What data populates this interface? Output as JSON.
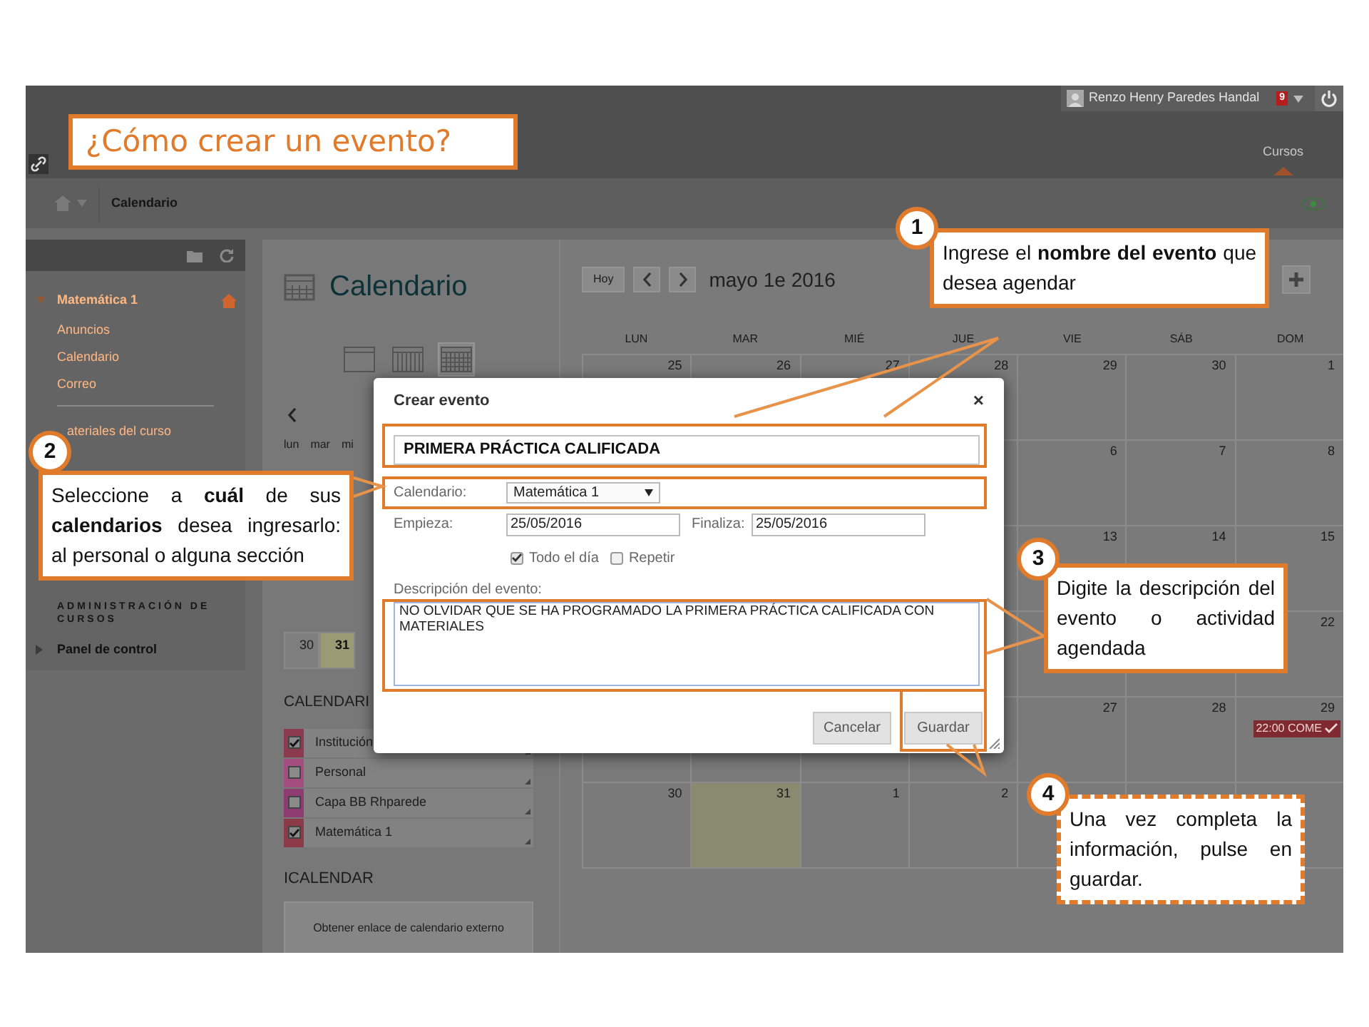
{
  "slide_title": "¿Cómo crear un evento?",
  "top_bar": {
    "user": "Renzo Henry Paredes Handal",
    "notification_count": "9"
  },
  "header": {
    "tab": "Cursos"
  },
  "breadcrumb": "Calendario",
  "sidebar": {
    "course": "Matemática 1",
    "items": [
      "Anuncios",
      "Calendario",
      "Correo"
    ],
    "materials": "ateriales del curso",
    "admin_heading": "ADMINISTRACIÓN DE CURSOS",
    "control_panel": "Panel de control"
  },
  "page_title": "Calendario",
  "views": [
    {
      "kind": "day",
      "selected": false
    },
    {
      "kind": "week",
      "selected": false
    },
    {
      "kind": "month",
      "selected": true
    }
  ],
  "mini_calendar": {
    "weekdays": [
      "lun",
      "mar",
      "mi"
    ],
    "days": [
      {
        "label": "30",
        "selected": false
      },
      {
        "label": "31",
        "selected": true
      }
    ]
  },
  "calendars_heading": "CALENDARI",
  "calendars": [
    {
      "name": "Institución",
      "checked": true,
      "color": "#8c3b4e"
    },
    {
      "name": "Personal",
      "checked": false,
      "color": "#a34d80"
    },
    {
      "name": "Capa BB Rhparede",
      "checked": false,
      "color": "#8d3b70"
    },
    {
      "name": "Matemática 1",
      "checked": true,
      "color": "#8c3a48"
    }
  ],
  "icalendar": {
    "heading": "ICALENDAR",
    "button": "Obtener enlace de calendario externo"
  },
  "calendar": {
    "today_button": "Hoy",
    "month": "mayo 1e 2016",
    "weekdays": [
      "LUN",
      "MAR",
      "MIÉ",
      "JUE",
      "VIE",
      "SÁB",
      "DOM"
    ],
    "weeks": [
      {
        "days": [
          {
            "label": "25",
            "today": false
          },
          {
            "label": "26",
            "today": false
          },
          {
            "label": "27",
            "today": false
          },
          {
            "label": "28",
            "today": false
          },
          {
            "label": "29",
            "today": false
          },
          {
            "label": "30",
            "today": false
          },
          {
            "label": "1",
            "today": false
          }
        ]
      },
      {
        "days": [
          {
            "label": "6",
            "today": false
          },
          {
            "label": "7",
            "today": false
          },
          {
            "label": "8",
            "today": false
          }
        ]
      },
      {
        "days": [
          {
            "label": "13",
            "today": false
          },
          {
            "label": "14",
            "today": false
          },
          {
            "label": "15",
            "today": false
          }
        ]
      },
      {
        "days": [
          {
            "label": "22",
            "today": false
          }
        ]
      },
      {
        "days": [
          {
            "label": "27",
            "today": false
          },
          {
            "label": "28",
            "today": false
          },
          {
            "label": "29",
            "today": false,
            "event": "22:00 COME"
          }
        ]
      },
      {
        "days": [
          {
            "label": "30",
            "today": false
          },
          {
            "label": "31",
            "today": true
          },
          {
            "label": "1",
            "today": false
          },
          {
            "label": "2",
            "today": false
          }
        ]
      }
    ]
  },
  "modal": {
    "title": "Crear evento",
    "close": "×",
    "name": "PRIMERA PRÁCTICA CALIFICADA",
    "calendar_label": "Calendario:",
    "calendar_value": "Matemática 1",
    "start_label": "Empieza:",
    "start": "25/05/2016",
    "end_label": "Finaliza:",
    "end": "25/05/2016",
    "options": [
      {
        "label": "Todo el día",
        "checked": true
      },
      {
        "label": "Repetir",
        "checked": false
      }
    ],
    "description_label": "Descripción del evento:",
    "description": "NO OLVIDAR QUE SE HA PROGRAMADO LA PRIMERA PRÁCTICA CALIFICADA CON MATERIALES",
    "buttons": [
      "Cancelar",
      "Guardar"
    ]
  },
  "callouts": [
    {
      "number": "1",
      "text": "Ingrese el **nombre del evento** que desea agendar",
      "kind": "step"
    },
    {
      "number": "2",
      "text": "Seleccione a **cuál** de sus **calendarios** desea ingresarlo: al personal o alguna sección",
      "kind": "step"
    },
    {
      "number": "3",
      "text": "Digite la descripción del evento o actividad agendada",
      "kind": "step"
    },
    {
      "number": "4",
      "text": "Una vez completa la información, pulse en guardar.",
      "kind": "final"
    }
  ]
}
